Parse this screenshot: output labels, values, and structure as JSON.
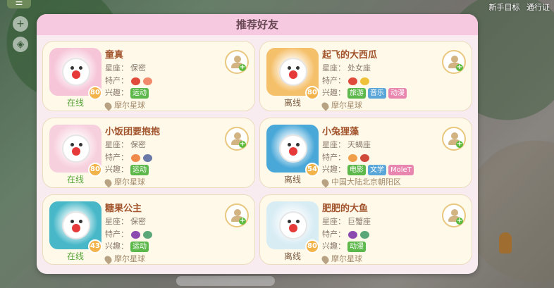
{
  "hud": {
    "menu_label": "☰",
    "top_right": [
      "新手目标",
      "通行证"
    ]
  },
  "panel": {
    "title": "推荐好友",
    "labels": {
      "constellation": "星座：",
      "specialty": "特产：",
      "interest": "兴趣："
    },
    "friends": [
      {
        "name": "童真",
        "constellation": "保密",
        "level": "80",
        "status": "在线",
        "online": true,
        "specialties": [
          "#e04a3a",
          "#f08a6a"
        ],
        "interests": [
          {
            "label": "运动",
            "color": "#5cb84a"
          }
        ],
        "location": "摩尔星球",
        "avatar_color": "#f6c6d8"
      },
      {
        "name": "起飞的大西瓜",
        "constellation": "处女座",
        "level": "80",
        "status": "离线",
        "online": false,
        "specialties": [
          "#e04a3a",
          "#f0c23a"
        ],
        "interests": [
          {
            "label": "旅游",
            "color": "#5cb84a"
          },
          {
            "label": "音乐",
            "color": "#5aa6d8"
          },
          {
            "label": "动漫",
            "color": "#e886b0"
          }
        ],
        "location": "摩尔星球",
        "avatar_color": "#f5c06a"
      },
      {
        "name": "小饭团要抱抱",
        "constellation": "保密",
        "level": "80",
        "status": "在线",
        "online": true,
        "specialties": [
          "#f08a4a",
          "#6a7aa8"
        ],
        "interests": [
          {
            "label": "运动",
            "color": "#5cb84a"
          }
        ],
        "location": "摩尔星球",
        "avatar_color": "#f7d0de"
      },
      {
        "name": "小兔狸藻",
        "constellation": "天蝎座",
        "level": "54",
        "status": "离线",
        "online": false,
        "specialties": [
          "#f0a04a",
          "#d04a3a"
        ],
        "interests": [
          {
            "label": "电影",
            "color": "#5cb84a"
          },
          {
            "label": "文学",
            "color": "#5aa6d8"
          },
          {
            "label": "MoleT",
            "color": "#e886b0"
          }
        ],
        "location": "中国大陆北京朝阳区",
        "avatar_color": "#4aa8d8"
      },
      {
        "name": "糖果公主",
        "constellation": "保密",
        "level": "43",
        "status": "在线",
        "online": true,
        "specialties": [
          "#8a4ab0",
          "#5aa878"
        ],
        "interests": [
          {
            "label": "运动",
            "color": "#5cb84a"
          }
        ],
        "location": "摩尔星球",
        "avatar_color": "#48b8c8"
      },
      {
        "name": "肥肥的大鱼",
        "constellation": "巨蟹座",
        "level": "80",
        "status": "离线",
        "online": false,
        "specialties": [
          "#8a4ab0",
          "#5aa878"
        ],
        "interests": [
          {
            "label": "动漫",
            "color": "#5cb84a"
          }
        ],
        "location": "摩尔星球",
        "avatar_color": "#d8ecf4"
      }
    ]
  }
}
